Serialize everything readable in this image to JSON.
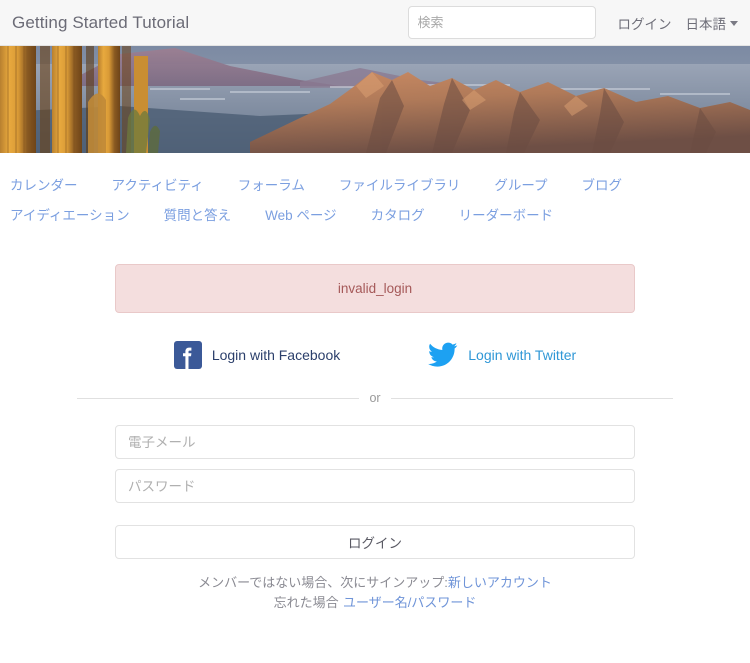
{
  "header": {
    "site_title": "Getting Started Tutorial",
    "search": {
      "placeholder": "検索",
      "value": ""
    },
    "login_link": "ログイン",
    "language": "日本語"
  },
  "banner": {
    "alt": "Desert landscape with saguaro cactus and mountains at sunset"
  },
  "nav": {
    "row1": [
      {
        "label": "カレンダー"
      },
      {
        "label": "アクティビティ"
      },
      {
        "label": "フォーラム"
      },
      {
        "label": "ファイルライブラリ"
      },
      {
        "label": "グループ"
      },
      {
        "label": "ブログ"
      }
    ],
    "row2": [
      {
        "label": "アイディエーション"
      },
      {
        "label": "質問と答え"
      },
      {
        "label": "Web ページ"
      },
      {
        "label": "カタログ"
      },
      {
        "label": "リーダーボード"
      }
    ]
  },
  "alert": {
    "message": "invalid_login"
  },
  "social": {
    "facebook_label": "Login with Facebook",
    "twitter_label": "Login with Twitter"
  },
  "divider": {
    "label": "or"
  },
  "form": {
    "email_placeholder": "電子メール",
    "email_value": "",
    "password_placeholder": "パスワード",
    "password_value": "",
    "submit_label": "ログイン"
  },
  "footer": {
    "signup_prefix": "メンバーではない場合、次にサインアップ:",
    "signup_link": "新しいアカウント",
    "forgot_prefix": "忘れた場合",
    "forgot_link": "ユーザー名/パスワード"
  },
  "colors": {
    "nav_link": "#7b9fe0",
    "alert_bg": "#f4dede",
    "alert_border": "#e9c9c9",
    "alert_text": "#a55959",
    "facebook_blue": "#3b5998",
    "twitter_blue": "#1da1f2",
    "header_bg": "#f7f7f7"
  }
}
